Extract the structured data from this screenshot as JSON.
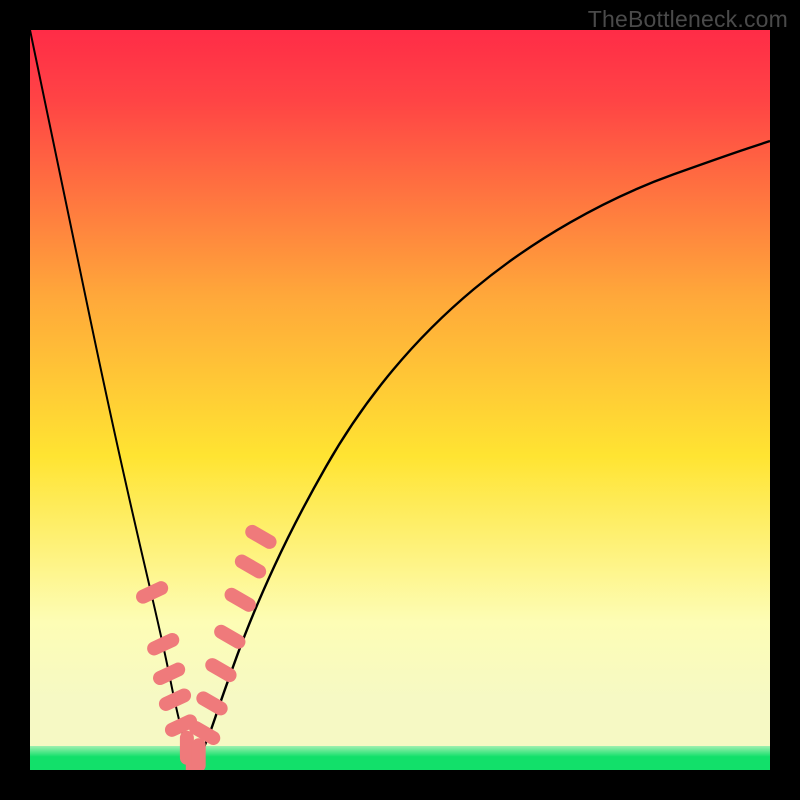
{
  "watermark": "TheBottleneck.com",
  "colors": {
    "red": "#ff2c47",
    "red2": "#ff4445",
    "orange": "#ffa83a",
    "yellow": "#ffe432",
    "pale": "#fdfdb5",
    "pale2": "#f6f9c4",
    "mint": "#9ff0b0",
    "green": "#12e06a",
    "bead": "#ef7a7b"
  },
  "chart_data": {
    "type": "line",
    "title": "",
    "xlabel": "",
    "ylabel": "",
    "xlim": [
      0,
      100
    ],
    "ylim": [
      0,
      100
    ],
    "note": "V-shaped bottleneck curve; minimum near x≈22. y is bottleneck %, background encodes severity (red=high, green=0).",
    "series": [
      {
        "name": "bottleneck-curve",
        "x": [
          0,
          5,
          10,
          14,
          18,
          20,
          22,
          24,
          26,
          30,
          36,
          44,
          54,
          66,
          80,
          94,
          100
        ],
        "values": [
          100,
          76,
          52,
          34,
          17,
          7,
          0,
          4,
          10,
          21,
          34,
          48,
          60,
          70,
          78,
          83,
          85
        ]
      }
    ],
    "markers": {
      "name": "highlight-beads",
      "x": [
        16.5,
        18.0,
        18.8,
        19.6,
        20.4,
        21.2,
        22.0,
        22.8,
        23.6,
        24.6,
        25.8,
        27.0,
        28.4,
        29.8,
        31.2
      ],
      "values": [
        24.0,
        17.0,
        13.0,
        9.5,
        6.0,
        3.0,
        0.5,
        2.0,
        5.0,
        9.0,
        13.5,
        18.0,
        23.0,
        27.5,
        31.5
      ]
    }
  }
}
